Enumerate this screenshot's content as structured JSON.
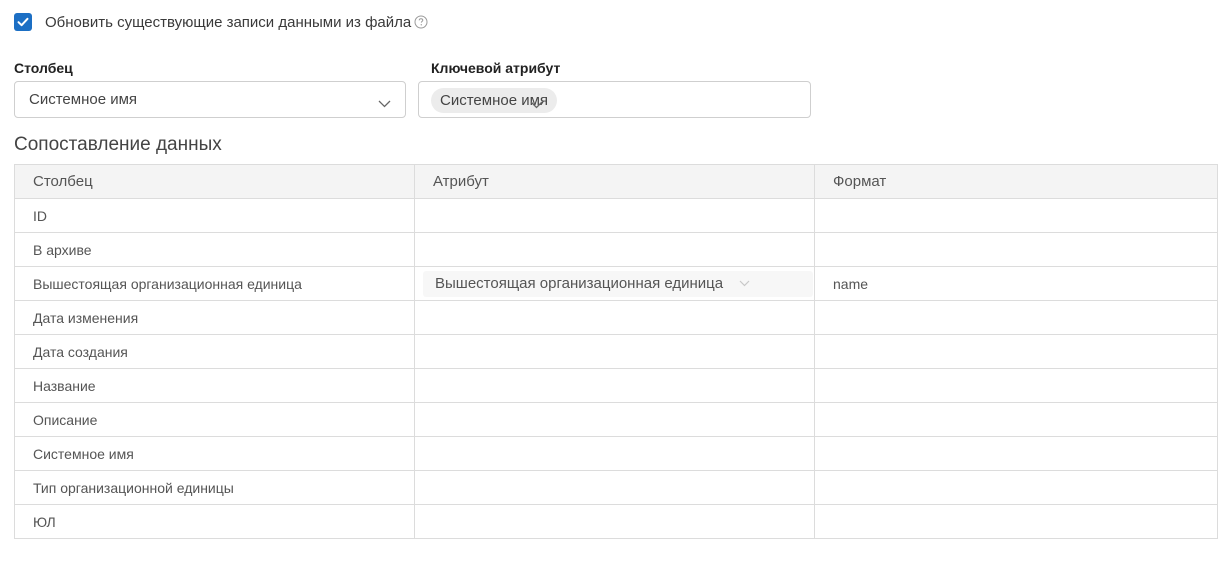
{
  "update": {
    "checked": true,
    "label": "Обновить существующие записи данными из файла"
  },
  "column_select": {
    "label": "Столбец",
    "value": "Системное имя"
  },
  "key_attribute": {
    "label": "Ключевой атрибут",
    "chip": "Системное имя"
  },
  "mapping": {
    "title": "Сопоставление данных",
    "headers": [
      "Столбец",
      "Атрибут",
      "Формат"
    ],
    "rows": [
      {
        "column": "ID",
        "attribute": "",
        "format": ""
      },
      {
        "column": "В архиве",
        "attribute": "",
        "format": ""
      },
      {
        "column": "Вышестоящая организационная единица",
        "attribute": "Вышестоящая организационная единица",
        "format": "name"
      },
      {
        "column": "Дата изменения",
        "attribute": "",
        "format": ""
      },
      {
        "column": "Дата создания",
        "attribute": "",
        "format": ""
      },
      {
        "column": "Название",
        "attribute": "",
        "format": ""
      },
      {
        "column": "Описание",
        "attribute": "",
        "format": ""
      },
      {
        "column": "Системное имя",
        "attribute": "",
        "format": ""
      },
      {
        "column": "Тип организационной единицы",
        "attribute": "",
        "format": ""
      },
      {
        "column": "ЮЛ",
        "attribute": "",
        "format": ""
      }
    ]
  },
  "colors": {
    "accent": "#1c6fc4",
    "border": "#dcdcdc",
    "header_bg": "#f4f4f4"
  },
  "icons": {
    "checkbox": "check-icon",
    "help": "question-circle-icon",
    "dropdown": "chevron-down-icon"
  }
}
